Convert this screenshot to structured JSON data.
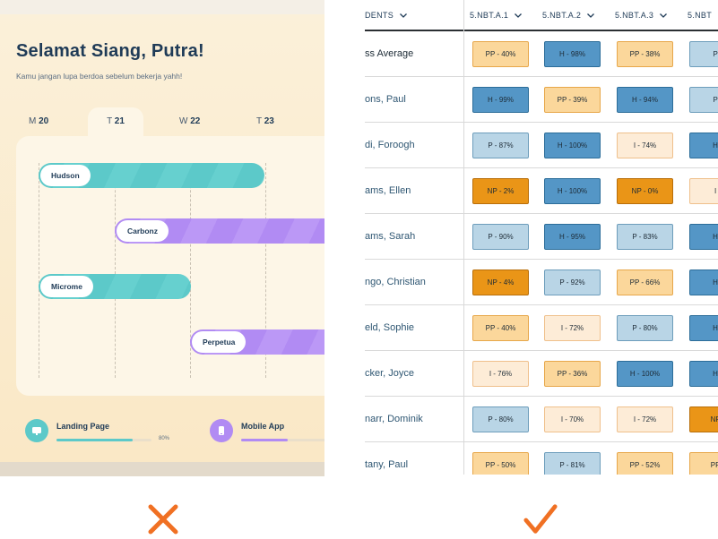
{
  "colors": {
    "cross": "#f07023",
    "check": "#f07023",
    "teal": "#5cc9c9",
    "purple": "#b18bf3",
    "heading": "#1f3b57"
  },
  "left_panel": {
    "greeting": "Selamat Siang, Putra!",
    "subtitle": "Kamu jangan lupa berdoa sebelum bekerja yahh!",
    "days": [
      {
        "letter": "M",
        "num": "20"
      },
      {
        "letter": "T",
        "num": "21"
      },
      {
        "letter": "W",
        "num": "22"
      },
      {
        "letter": "T",
        "num": "23"
      }
    ],
    "tasks": [
      {
        "label": "Hudson",
        "color": "teal"
      },
      {
        "label": "Carbonz",
        "color": "purple"
      },
      {
        "label": "Microme",
        "color": "teal"
      },
      {
        "label": "Perpetua",
        "color": "purple"
      }
    ],
    "projects": [
      {
        "name": "Landing Page",
        "progress_label": "80%",
        "progress": 0.8,
        "icon": "monitor-icon"
      },
      {
        "name": "Mobile App",
        "progress_label": "",
        "progress": 0.6,
        "icon": "phone-icon"
      }
    ]
  },
  "table": {
    "header": {
      "students": "DENTS",
      "columns": [
        "5.NBT.A.1",
        "5.NBT.A.2",
        "5.NBT.A.3",
        "5.NBT"
      ]
    },
    "rows": [
      {
        "name": "ss Average",
        "scores": [
          {
            "level": "PP",
            "text": "PP - 40%"
          },
          {
            "level": "H",
            "text": "H - 98%"
          },
          {
            "level": "PP",
            "text": "PP - 38%"
          },
          {
            "level": "P",
            "text": "P -"
          }
        ]
      },
      {
        "name": "ons, Paul",
        "scores": [
          {
            "level": "H",
            "text": "H - 99%"
          },
          {
            "level": "PP",
            "text": "PP - 39%"
          },
          {
            "level": "H",
            "text": "H - 94%"
          },
          {
            "level": "P",
            "text": "P -"
          }
        ]
      },
      {
        "name": "di, Foroogh",
        "scores": [
          {
            "level": "P",
            "text": "P - 87%"
          },
          {
            "level": "H",
            "text": "H - 100%"
          },
          {
            "level": "I",
            "text": "I - 74%"
          },
          {
            "level": "H",
            "text": "H -"
          }
        ]
      },
      {
        "name": "ams, Ellen",
        "scores": [
          {
            "level": "NP",
            "text": "NP - 2%"
          },
          {
            "level": "H",
            "text": "H - 100%"
          },
          {
            "level": "NP",
            "text": "NP - 0%"
          },
          {
            "level": "I",
            "text": "I -"
          }
        ]
      },
      {
        "name": "ams, Sarah",
        "scores": [
          {
            "level": "P",
            "text": "P - 90%"
          },
          {
            "level": "H",
            "text": "H - 95%"
          },
          {
            "level": "P",
            "text": "P - 83%"
          },
          {
            "level": "H",
            "text": "H -"
          }
        ]
      },
      {
        "name": "ngo, Christian",
        "scores": [
          {
            "level": "NP",
            "text": "NP - 4%"
          },
          {
            "level": "P",
            "text": "P - 92%"
          },
          {
            "level": "PP",
            "text": "PP - 66%"
          },
          {
            "level": "H",
            "text": "H -"
          }
        ]
      },
      {
        "name": "eld, Sophie",
        "scores": [
          {
            "level": "PP",
            "text": "PP - 40%"
          },
          {
            "level": "I",
            "text": "I - 72%"
          },
          {
            "level": "P",
            "text": "P - 80%"
          },
          {
            "level": "H",
            "text": "H -"
          }
        ]
      },
      {
        "name": "cker, Joyce",
        "scores": [
          {
            "level": "I",
            "text": "I - 76%"
          },
          {
            "level": "PP",
            "text": "PP - 36%"
          },
          {
            "level": "H",
            "text": "H - 100%"
          },
          {
            "level": "H",
            "text": "H -"
          }
        ]
      },
      {
        "name": "narr, Dominik",
        "scores": [
          {
            "level": "P",
            "text": "P - 80%"
          },
          {
            "level": "I",
            "text": "I - 70%"
          },
          {
            "level": "I",
            "text": "I - 72%"
          },
          {
            "level": "NP",
            "text": "NP -"
          }
        ]
      },
      {
        "name": "tany, Paul",
        "scores": [
          {
            "level": "PP",
            "text": "PP - 50%"
          },
          {
            "level": "P",
            "text": "P - 81%"
          },
          {
            "level": "PP",
            "text": "PP - 52%"
          },
          {
            "level": "PP",
            "text": "PP -"
          }
        ]
      }
    ]
  }
}
